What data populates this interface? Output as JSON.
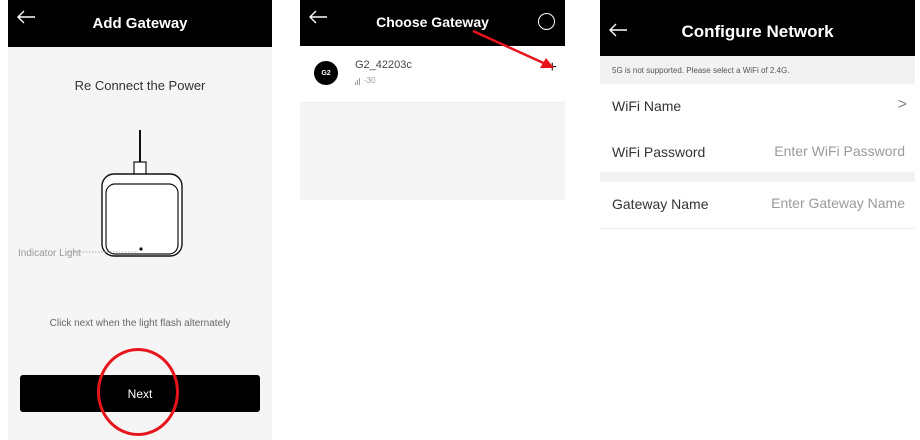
{
  "panel1": {
    "title": "Add Gateway",
    "instruction": "Re Connect the Power",
    "indicator_label": "Indicator Light",
    "hint": "Click next when the light flash alternately",
    "next_button": "Next"
  },
  "panel2": {
    "title": "Choose Gateway",
    "gateway": {
      "badge": "G2",
      "name": "G2_42203c",
      "signal": "-30",
      "add_label": "+"
    }
  },
  "panel3": {
    "title": "Configure Network",
    "notice": "5G is not supported. Please select a WiFi of 2.4G.",
    "wifi_name_label": "WiFi Name",
    "wifi_password_label": "WiFi Password",
    "wifi_password_placeholder": "Enter WiFi Password",
    "gateway_name_label": "Gateway Name",
    "gateway_name_placeholder": "Enter Gateway Name",
    "chevron": ">"
  },
  "colors": {
    "header_bg": "#000000",
    "annotation_red": "#e8141c",
    "screen_bg": "#f5f5f5"
  },
  "icons": [
    "back-arrow-icon",
    "refresh-icon",
    "add-icon",
    "chevron-right-icon",
    "signal-icon"
  ]
}
